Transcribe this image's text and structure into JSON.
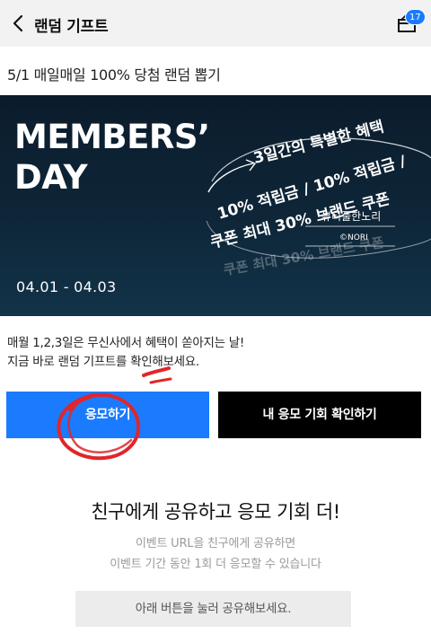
{
  "header": {
    "title": "랜덤 기프트",
    "badge_count": "17",
    "back_icon": "chevron-left-icon",
    "gift_icon": "gift-box-icon"
  },
  "event": {
    "title": "5/1 매일매일 100% 당첨 랜덤 뽑기"
  },
  "banner": {
    "heading_line1": "MEMBERS’",
    "heading_line2": "DAY",
    "ring_text_1": "3일간의 특별한 혜택",
    "ring_text_2": "10% 적립금 / 10% 적립금 /",
    "ring_text_3": "쿠폰 최대 30% 브랜드 쿠폰",
    "brand_name": "뷰티풀한노리",
    "brand_sub": "©NORI",
    "date_range": "04.01 - 04.03",
    "colors": {
      "bg_top": "#0b1c2c",
      "bg_bottom": "#123349",
      "text": "#ffffff"
    }
  },
  "description": {
    "line1": "매월 1,2,3일은 무신사에서 혜택이 쏟아지는 날!",
    "line2": "지금 바로 랜덤 기프트를 확인해보세요."
  },
  "buttons": {
    "apply": "응모하기",
    "check_chances": "내 응모 기회 확인하기"
  },
  "share": {
    "title": "친구에게 공유하고 응모 기회 더!",
    "sub_line1": "이벤트 URL을 친구에게 공유하면",
    "sub_line2": "이벤트 기간 동안 1회 더 응모할 수 있습니다",
    "button": "아래 버튼을 눌러 공유해보세요."
  },
  "colors": {
    "accent": "#1a7bff",
    "dark_button": "#000000",
    "annotation_red": "#e0262a",
    "header_bg": "#f2f2f2"
  }
}
